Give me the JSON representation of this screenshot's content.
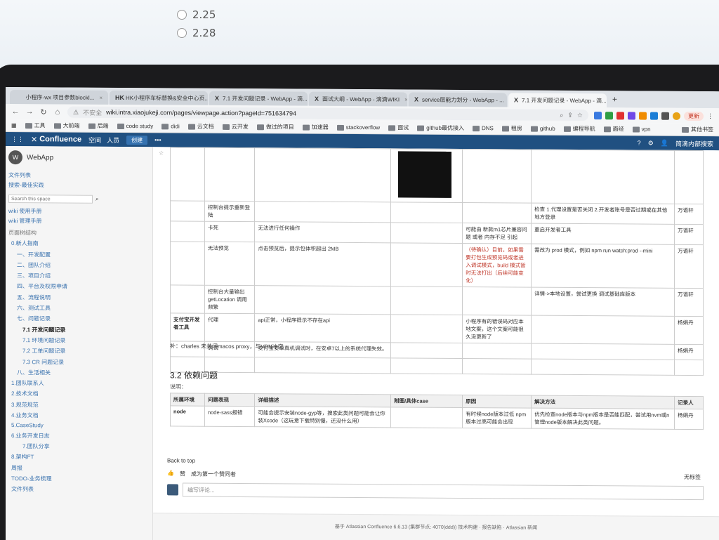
{
  "quiz": {
    "options": [
      "2.25",
      "2.28"
    ]
  },
  "browser": {
    "tabs": [
      {
        "icon": "",
        "title": "小程序-wx 项目参数blockl...",
        "active": false
      },
      {
        "icon": "HK",
        "title": "HK小程序车标替换&安全中心页...",
        "active": false
      },
      {
        "icon": "X",
        "title": "7.1 开发问题记录 - WebApp - 滴...",
        "active": false
      },
      {
        "icon": "X",
        "title": "面试大纲 - WebApp - 滴滴WIKI",
        "active": false
      },
      {
        "icon": "X",
        "title": "service层能力划分 - WebApp - ...",
        "active": false
      },
      {
        "icon": "X",
        "title": "7.1 开发问题记录 - WebApp - 滴...",
        "active": true
      }
    ],
    "new_tab": "+",
    "insecure_label": "不安全",
    "url": "wiki.intra.xiaojukeji.com/pages/viewpage.action?pageId=751634794",
    "update_label": "更新",
    "bookmarks": [
      "工具",
      "大前端",
      "后端",
      "code study",
      "didi",
      "云文档",
      "云开发",
      "做过的项目",
      "加速器",
      "stackoverflow",
      "面试",
      "github最优接入",
      "DNS",
      "租房",
      "github",
      "编程导航",
      "面经",
      "vpn"
    ],
    "other_bookmarks": "其他书签"
  },
  "confluence": {
    "logo": "Confluence",
    "nav": [
      "空间",
      "人员"
    ],
    "create_label": "创建",
    "right_items": [
      "?",
      "⚙",
      "👤",
      "简滴内部搜索"
    ]
  },
  "sidebar": {
    "space_name": "WebApp",
    "links": [
      "文件列表",
      "搜索-最佳实践"
    ],
    "search_placeholder": "Search this space",
    "wiki_links": [
      "wiki 使用手册",
      "wiki 管理手册"
    ],
    "section_label": "页面树结构",
    "tree": [
      {
        "label": "0.新人指南",
        "current": false
      },
      {
        "label": "一、开发配置",
        "current": false
      },
      {
        "label": "二、团队介绍",
        "current": false
      },
      {
        "label": "三、项目介绍",
        "current": false
      },
      {
        "label": "四、平台及权限申请",
        "current": false
      },
      {
        "label": "五、流程说明",
        "current": false
      },
      {
        "label": "六、测试工具",
        "current": false
      },
      {
        "label": "七、问题记录",
        "current": false
      },
      {
        "label": "7.1 开发问题记录",
        "current": true
      },
      {
        "label": "7.1 环境问题记录",
        "current": false
      },
      {
        "label": "7.2 工单问题记录",
        "current": false
      },
      {
        "label": "7.3 CR 问题记录",
        "current": false
      },
      {
        "label": "八、生活相关",
        "current": false
      },
      {
        "label": "1.团队联系人",
        "current": false
      },
      {
        "label": "2.技术文档",
        "current": false
      },
      {
        "label": "3.规范规范",
        "current": false
      },
      {
        "label": "4.业务文档",
        "current": false
      },
      {
        "label": "5.CaseStudy",
        "current": false
      },
      {
        "label": "6.业务开发日志",
        "current": false
      },
      {
        "label": "7.团队分享",
        "current": false
      },
      {
        "label": "8.架构FT",
        "current": false
      },
      {
        "label": "周报",
        "current": false
      },
      {
        "label": "TODO-业务梳理",
        "current": false
      },
      {
        "label": "文件列表",
        "current": false
      }
    ]
  },
  "table1": {
    "rows": [
      {
        "env": "",
        "issue": "控制台提示重新登陆",
        "detail": "",
        "attach": "",
        "cause": "",
        "fix": "检查 1.代理设置是否关闭 2.开发者账号是否过期或在其他地方登录",
        "owner": "万语轩"
      },
      {
        "env": "",
        "issue": "卡死",
        "detail": "无法进行任何操作",
        "attach": "",
        "cause": "可能由 新款m1芯片兼容问题 或者 内存不足 引起",
        "fix": "重启开发者工具",
        "owner": "万语轩"
      },
      {
        "env": "",
        "issue": "无法预览",
        "detail": "点击预览后，提示包体积超出 2MB",
        "attach": "",
        "cause": "（待确认）目前，如果需要打包生成预览码或者进入调试模式，build 模式暂时无法打出（后续可能变化）",
        "fix": "需改为 prod 模式，例如 npm run watch:prod --mini",
        "owner": "万语轩"
      },
      {
        "env": "",
        "issue": "控制台大量输出 getLocation 调用频繁",
        "detail": "",
        "attach": "",
        "cause": "",
        "fix": "详情->本地设置，尝试更换 调试基础库版本",
        "owner": "万语轩"
      },
      {
        "env": "支付宝开发者工具",
        "issue": "代理",
        "detail": "api正常，小程序提示不存在api",
        "attach": "",
        "cause": "小程序有的错误码对应本地文案，这个文案可能很久没更新了",
        "fix": "",
        "owner": "杨娟丹"
      },
      {
        "env": "",
        "issue": "调试",
        "detail": "支付宝安卓真机调试时，在安卓7以上的系统代理失效。",
        "attach": "",
        "cause": "",
        "fix": "",
        "owner": "杨娟丹"
      }
    ]
  },
  "note": "补：charles 未关闭macos proxy，与VPN冲突",
  "section_title": "3.2 依赖问题",
  "section_desc": "说明：",
  "table2": {
    "headers": [
      "所属环境",
      "问题表现",
      "详细描述",
      "附图/具体case",
      "原因",
      "解决方法",
      "记录人"
    ],
    "rows": [
      [
        "node",
        "node-sass报错",
        "可能会提示安装node-gyp等，搜索此类问题可能会让你装Xcode（这玩意下载特别慢，还没什么用）",
        "",
        "有时候node版本过低 npm版本过高可能会出现",
        "优先检查node版本与npm版本是否能匹配，尝试用nvm或n管理node版本解决此类问题。",
        "杨娟丹"
      ]
    ]
  },
  "back_to_top": "Back to top",
  "like": {
    "label": "赞",
    "text": "成为第一个赞同者",
    "right": "无标签"
  },
  "comment_placeholder": "编写评论...",
  "footer": "基于 Atlassian Confluence 6.6.13 (集群节点: 4070(ddd)) 技术构建 · 报告缺陷 · Atlassian 新闻"
}
